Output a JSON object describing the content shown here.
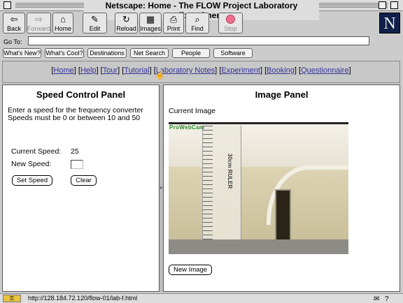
{
  "window": {
    "title": "Netscape: Home - The FLOW Project Laboratory Experiment"
  },
  "toolbar": {
    "back": {
      "label": "Back",
      "icon": "left-arrow-icon"
    },
    "forward": {
      "label": "Forward",
      "icon": "right-arrow-icon"
    },
    "home": {
      "label": "Home",
      "icon": "house-icon"
    },
    "edit": {
      "label": "Edit",
      "icon": "pencil-icon"
    },
    "reload": {
      "label": "Reload",
      "icon": "reload-icon"
    },
    "images": {
      "label": "Images",
      "icon": "images-icon"
    },
    "print": {
      "label": "Print",
      "icon": "printer-icon"
    },
    "find": {
      "label": "Find",
      "icon": "binoculars-icon"
    },
    "stop": {
      "label": "Stop",
      "icon": "stop-icon",
      "color": "#ee6f8d"
    },
    "logo": "N"
  },
  "location": {
    "label": "Go To:",
    "value": ""
  },
  "directory_buttons": [
    "What's New?",
    "What's Cool?",
    "Destinations",
    "Net Search",
    "People",
    "Software"
  ],
  "nav": {
    "links": [
      "Home",
      "Help",
      "Tour",
      "Tutorial",
      "Laboratory Notes",
      "Experiment",
      "Booking",
      "Questionnaire"
    ],
    "link_color": "#33339a"
  },
  "speed_panel": {
    "title": "Speed Control Panel",
    "instruction": "Enter a speed for the frequency converter",
    "rule": "Speeds must be 0 or between 10 and 50",
    "current_label": "Current Speed:",
    "current_value": "25",
    "new_label": "New Speed:",
    "new_value": "",
    "set_button": "Set Speed",
    "clear_button": "Clear"
  },
  "image_panel": {
    "title": "Image Panel",
    "current_label": "Current Image",
    "webcam_stamp": "ProWebCam",
    "ruler_text": "30cm RULER",
    "new_image_button": "New Image"
  },
  "status": {
    "url": "http://128.184.72.120/flow-01/lab-f.html"
  }
}
